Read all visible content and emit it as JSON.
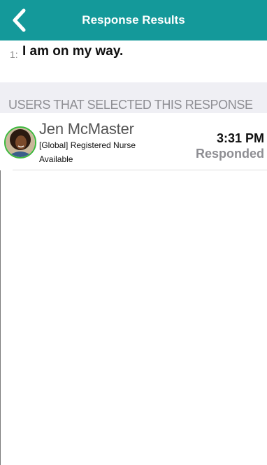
{
  "header": {
    "title": "Response Results",
    "back_icon": "chevron-left-icon",
    "background_color": "#14999a"
  },
  "question": {
    "number": "1:",
    "text": "I am on my way."
  },
  "section": {
    "label": "USERS THAT SELECTED THIS RESPONSE"
  },
  "users": [
    {
      "name": "Jen McMaster",
      "role": "[Global] Registered Nurse",
      "status": "Available",
      "time": "3:31 PM",
      "response_state": "Responded",
      "presence_color": "#3db83d"
    }
  ]
}
